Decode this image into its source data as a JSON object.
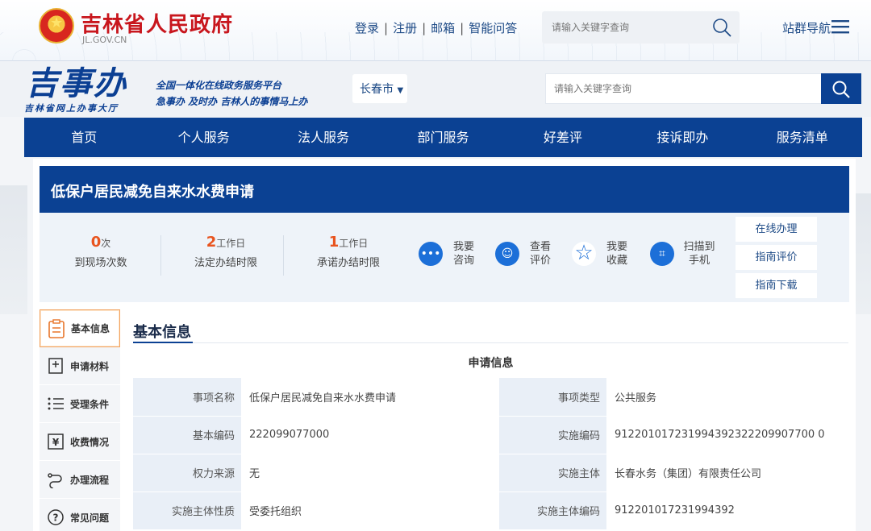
{
  "gov": {
    "name": "吉林省人民政府",
    "domain": "JL.GOV.CN",
    "links": [
      "登录",
      "注册",
      "邮箱",
      "智能问答"
    ],
    "search_placeholder": "请输入关键字查询",
    "site_nav": "站群导航"
  },
  "brand": {
    "name": "吉事办",
    "subtitle": "吉林省网上办事大厅",
    "slogan1": "全国一体化在线政务服务平台",
    "slogan2": "急事办 及时办 吉林人的事情马上办",
    "city": "长春市",
    "search_placeholder": "请输入关键字查询"
  },
  "nav": [
    "首页",
    "个人服务",
    "法人服务",
    "部门服务",
    "好差评",
    "接诉即办",
    "服务清单"
  ],
  "item": {
    "title": "低保户居民减免自来水水费申请"
  },
  "stats": [
    {
      "num": "0",
      "unit": "次",
      "label": "到现场次数"
    },
    {
      "num": "2",
      "unit": "工作日",
      "label": "法定办结时限"
    },
    {
      "num": "1",
      "unit": "工作日",
      "label": "承诺办结时限"
    }
  ],
  "actions": [
    {
      "icon": "chat-icon",
      "line1": "我要",
      "line2": "咨询"
    },
    {
      "icon": "smile-icon",
      "line1": "查看",
      "line2": "评价"
    },
    {
      "icon": "star-icon",
      "line1": "我要",
      "line2": "收藏"
    },
    {
      "icon": "scan-icon",
      "line1": "扫描到",
      "line2": "手机"
    }
  ],
  "side_buttons": [
    "在线办理",
    "指南评价",
    "指南下载"
  ],
  "side_menu": [
    {
      "icon": "document-icon",
      "label": "基本信息"
    },
    {
      "icon": "materials-icon",
      "label": "申请材料"
    },
    {
      "icon": "list-icon",
      "label": "受理条件"
    },
    {
      "icon": "yuan-icon",
      "label": "收费情况"
    },
    {
      "icon": "flow-icon",
      "label": "办理流程"
    },
    {
      "icon": "question-icon",
      "label": "常见问题"
    }
  ],
  "section": {
    "title": "基本信息",
    "caption": "申请信息",
    "rows": [
      {
        "k1": "事项名称",
        "v1": "低保户居民减免自来水水费申请",
        "k2": "事项类型",
        "v2": "公共服务"
      },
      {
        "k1": "基本编码",
        "v1": "222099077000",
        "k2": "实施编码",
        "v2": "912201017231994392322209907700 0"
      },
      {
        "k1": "权力来源",
        "v1": "无",
        "k2": "实施主体",
        "v2": "长春水务（集团）有限责任公司"
      },
      {
        "k1": "实施主体性质",
        "v1": "受委托组织",
        "k2": "实施主体编码",
        "v2": "912201017231994392"
      }
    ]
  }
}
